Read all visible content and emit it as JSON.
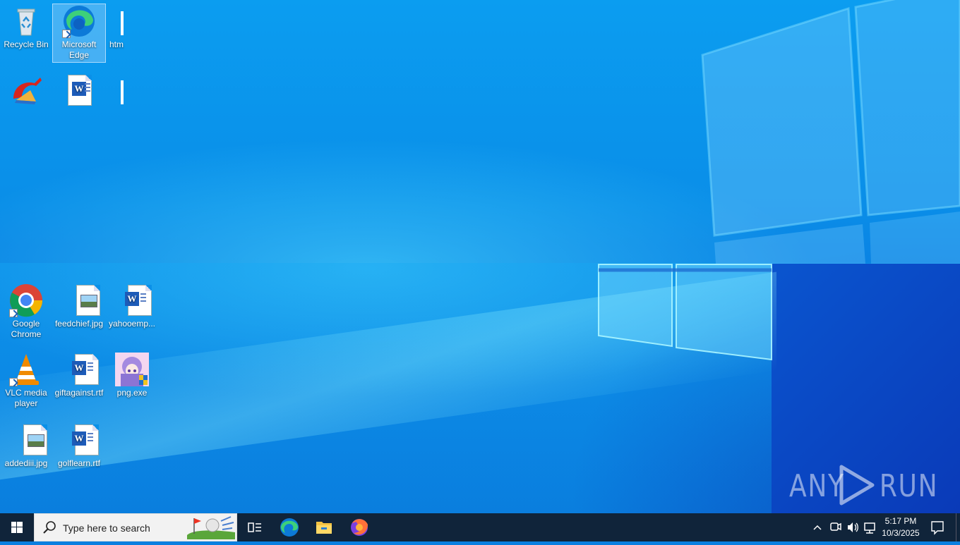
{
  "desktop": {
    "icons": [
      {
        "label": "Recycle Bin"
      },
      {
        "label": "Microsoft Edge"
      },
      {
        "label": "htm"
      },
      {
        "label": ""
      },
      {
        "label": ""
      },
      {
        "label": ""
      },
      {
        "label": "Google Chrome"
      },
      {
        "label": "feedchief.jpg"
      },
      {
        "label": "yahooemp..."
      },
      {
        "label": "VLC media player"
      },
      {
        "label": "giftagainst.rtf"
      },
      {
        "label": "png.exe"
      },
      {
        "label": "addediii.jpg"
      },
      {
        "label": "golflearn.rtf"
      }
    ],
    "selected_icon": "Microsoft Edge"
  },
  "watermark": {
    "text": "ANY RUN"
  },
  "taskbar": {
    "search_placeholder": "Type here to search",
    "pinned": [
      "task-view",
      "microsoft-edge",
      "file-explorer",
      "firefox"
    ],
    "clock": {
      "time": "5:17 PM",
      "date": "10/3/2025"
    }
  },
  "colors": {
    "wallpaper_primary": "#0a8ee8",
    "taskbar": "#10243a",
    "accent": "#1d5bb8"
  }
}
